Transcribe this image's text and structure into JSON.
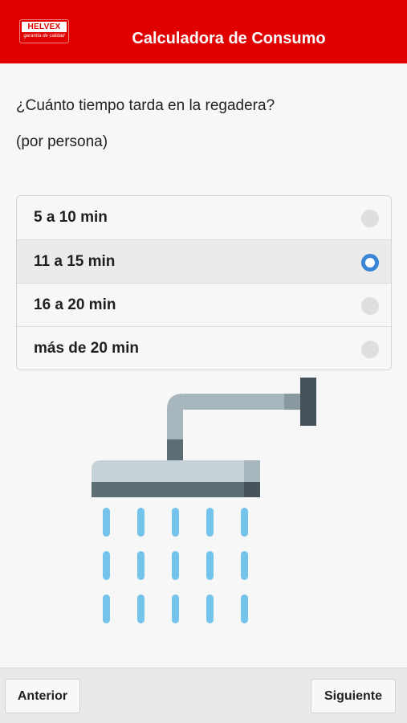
{
  "header": {
    "logo_brand": "HELVEX",
    "logo_tagline": "garantía de calidad",
    "title": "Calculadora de Consumo",
    "background_color": "#e10000"
  },
  "question": {
    "text": "¿Cuánto tiempo tarda en la regadera?",
    "subtext": "(por persona)"
  },
  "options": [
    {
      "label": "5 a 10 min",
      "selected": false
    },
    {
      "label": "11 a 15 min",
      "selected": true
    },
    {
      "label": "16 a 20 min",
      "selected": false
    },
    {
      "label": "más de 20 min",
      "selected": false
    }
  ],
  "illustration": {
    "icon": "shower-head-icon",
    "colors": {
      "pipe": "#a7b5bc",
      "pipe_dark": "#5d6d74",
      "head_top": "#c5d2d8",
      "head_bottom": "#5d6d74",
      "water": "#74c3ea"
    }
  },
  "footer": {
    "prev_label": "Anterior",
    "next_label": "Siguiente"
  },
  "accent_color": "#3b86d6"
}
